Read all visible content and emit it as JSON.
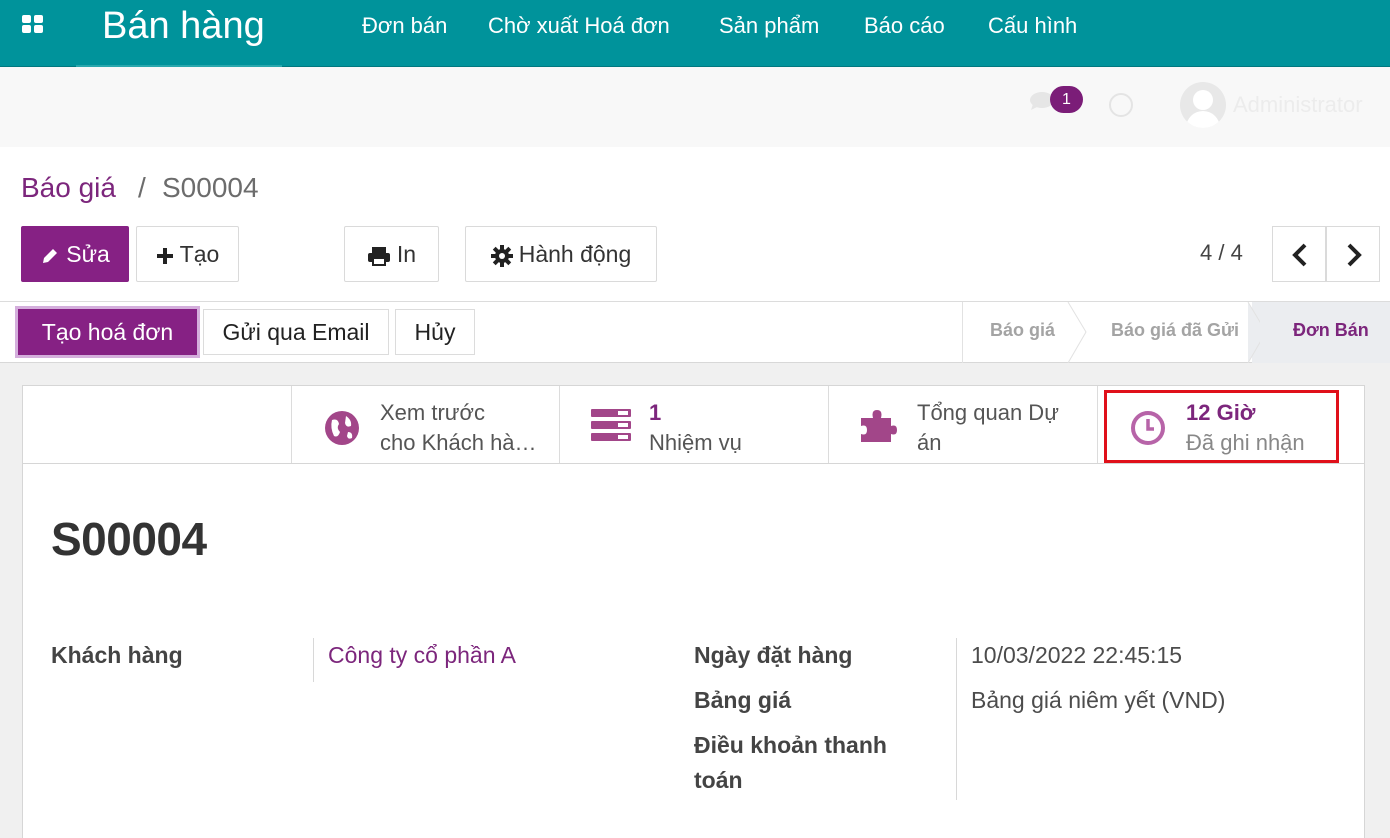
{
  "topbar": {
    "app_name": "Bán hàng",
    "menu": [
      "Đơn bán",
      "Chờ xuất Hoá đơn",
      "Sản phẩm",
      "Báo cáo",
      "Cấu hình"
    ]
  },
  "systray": {
    "message_count": "1",
    "user_name": "Administrator"
  },
  "breadcrumb": {
    "parent": "Báo giá",
    "separator": "/",
    "current": "S00004"
  },
  "toolbar": {
    "edit_label": "Sửa",
    "create_label": "Tạo",
    "print_label": "In",
    "action_label": "Hành động"
  },
  "pager": {
    "value": "4 / 4"
  },
  "status_buttons": {
    "create_invoice": "Tạo hoá đơn",
    "send_email": "Gửi qua Email",
    "cancel": "Hủy"
  },
  "stages": [
    "Báo giá",
    "Báo giá đã Gửi",
    "Đơn Bán"
  ],
  "active_stage": "Đơn Bán",
  "smart_buttons": {
    "preview": {
      "line1": "Xem trước",
      "line2": "cho Khách hà…"
    },
    "tasks": {
      "value": "1",
      "label": "Nhiệm vụ"
    },
    "project": {
      "line1": "Tổng quan Dự",
      "line2": "án"
    },
    "timesheet": {
      "value": "12 Giờ",
      "label": "Đã ghi nhận"
    }
  },
  "form": {
    "title": "S00004",
    "customer_label": "Khách hàng",
    "customer_value": "Công ty cổ phần A",
    "order_date_label": "Ngày đặt hàng",
    "order_date_value": "10/03/2022 22:45:15",
    "pricelist_label": "Bảng giá",
    "pricelist_value": "Bảng giá niêm yết (VND)",
    "payment_terms_label_line1": "Điều khoản thanh",
    "payment_terms_label_line2": "toán"
  },
  "colors": {
    "topbar": "#00939b",
    "primary": "#862184",
    "link": "#7c267c",
    "highlight": "#e0101a"
  }
}
